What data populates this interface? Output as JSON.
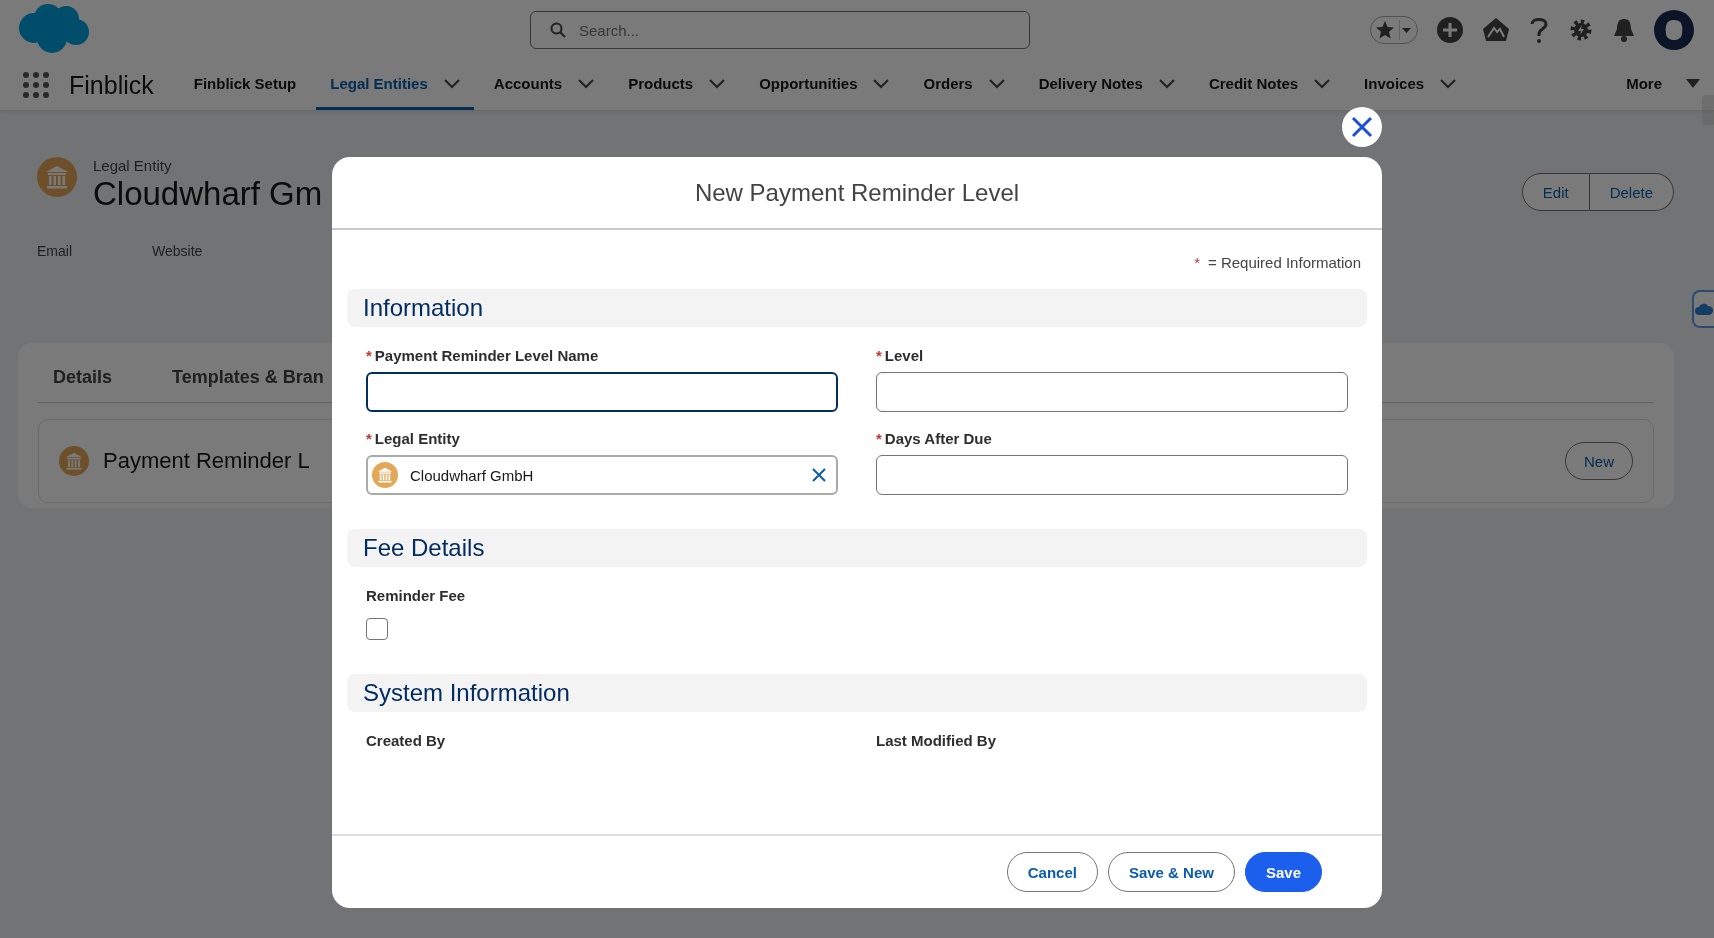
{
  "header": {
    "search": {
      "placeholder": "Search..."
    }
  },
  "nav": {
    "app_name": "Finblick",
    "items": [
      {
        "label": "Finblick Setup",
        "kind": "plain",
        "selected": false
      },
      {
        "label": "Legal Entities",
        "kind": "menu",
        "selected": true
      },
      {
        "label": "Accounts",
        "kind": "menu",
        "selected": false
      },
      {
        "label": "Products",
        "kind": "menu",
        "selected": false
      },
      {
        "label": "Opportunities",
        "kind": "menu",
        "selected": false
      },
      {
        "label": "Orders",
        "kind": "menu",
        "selected": false
      },
      {
        "label": "Delivery Notes",
        "kind": "menu",
        "selected": false
      },
      {
        "label": "Credit Notes",
        "kind": "menu",
        "selected": false
      },
      {
        "label": "Invoices",
        "kind": "menu",
        "selected": false
      },
      {
        "label": "More",
        "kind": "overflow",
        "selected": false
      }
    ]
  },
  "record": {
    "type_label": "Legal Entity",
    "title": "Cloudwharf Gm",
    "actions": [
      "Edit",
      "Delete"
    ],
    "fields": [
      "Email",
      "Website"
    ],
    "tabs": [
      "Details",
      "Templates & Bran"
    ],
    "related_list": {
      "title": "Payment Reminder L",
      "button": "New"
    }
  },
  "modal": {
    "title": "New Payment Reminder Level",
    "required_legend": {
      "mark": "*",
      "text": "= Required Information"
    },
    "sections": [
      {
        "title": "Information",
        "fields": [
          {
            "kind": "text",
            "label": "Payment Reminder Level Name",
            "required_mark": "*",
            "focused": true
          },
          {
            "kind": "text",
            "label": "Level",
            "required_mark": "*",
            "focused": false
          },
          {
            "kind": "lookup",
            "label": "Legal Entity",
            "required_mark": "*",
            "value": "Cloudwharf GmbH"
          },
          {
            "kind": "text",
            "label": "Days After Due",
            "required_mark": "*",
            "focused": false
          }
        ]
      },
      {
        "title": "Fee Details",
        "fields": [
          {
            "kind": "checkbox",
            "label": "Reminder Fee",
            "checked": false
          }
        ]
      },
      {
        "title": "System Information",
        "fields": [
          {
            "kind": "readonly",
            "label": "Created By"
          },
          {
            "kind": "readonly",
            "label": "Last Modified By"
          }
        ]
      }
    ],
    "buttons": [
      {
        "label": "Cancel",
        "kind": "neutral"
      },
      {
        "label": "Save & New",
        "kind": "neutral"
      },
      {
        "label": "Save",
        "kind": "brand"
      }
    ]
  }
}
